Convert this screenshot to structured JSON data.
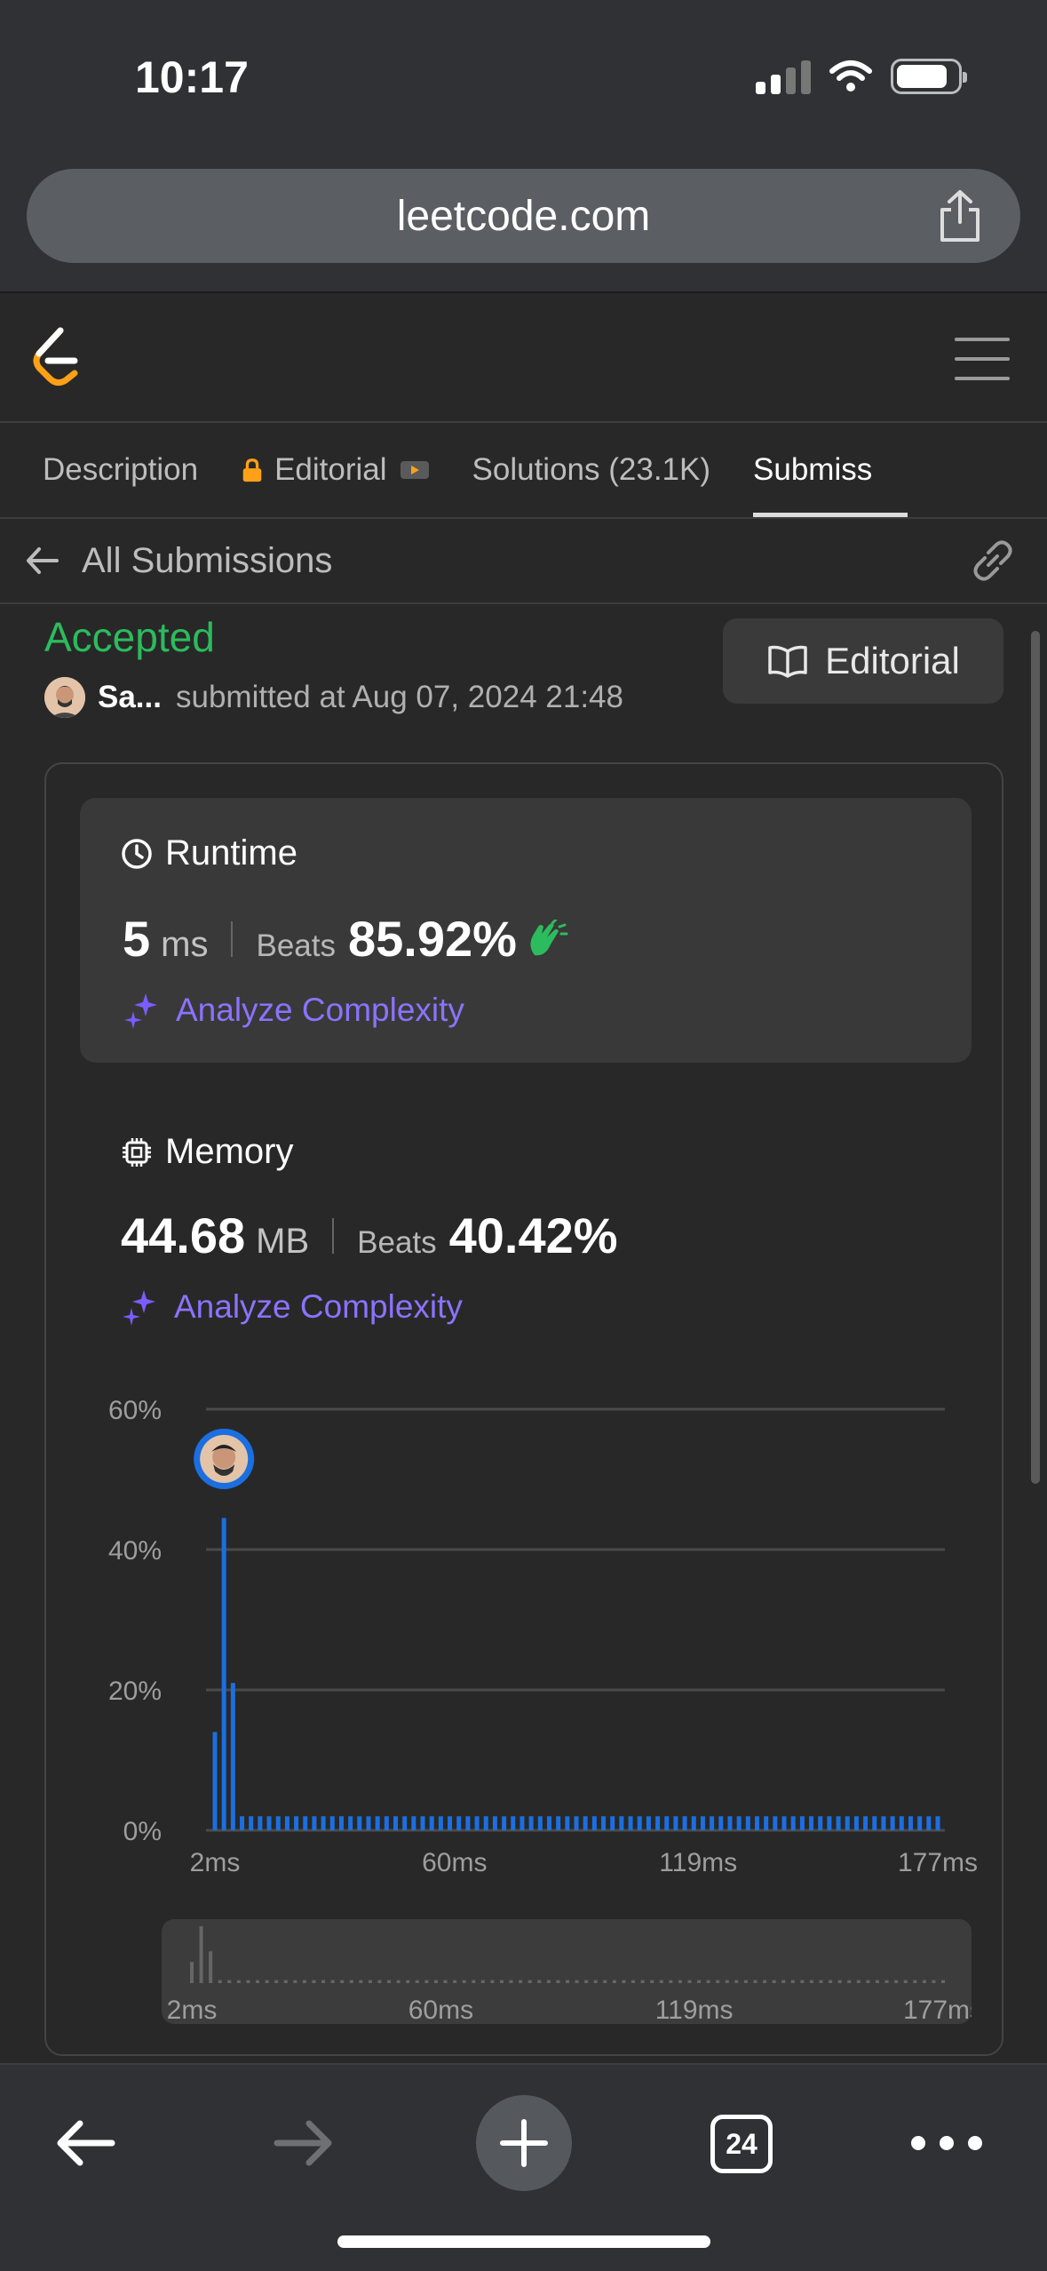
{
  "status_bar": {
    "time": "10:17"
  },
  "browser": {
    "url": "leetcode.com",
    "tab_count": "24"
  },
  "tabs": [
    {
      "label": "Description"
    },
    {
      "label": "Editorial"
    },
    {
      "label": "Solutions (23.1K)"
    },
    {
      "label": "Submiss"
    }
  ],
  "subnav": {
    "title": "All Submissions"
  },
  "submission": {
    "status": "Accepted",
    "user": "Sa...",
    "submitted_text": "submitted at Aug 07, 2024 21:48",
    "editorial_label": "Editorial"
  },
  "runtime": {
    "title": "Runtime",
    "value": "5",
    "unit": "ms",
    "beats_label": "Beats",
    "beats": "85.92%",
    "analyze_label": "Analyze Complexity"
  },
  "memory": {
    "title": "Memory",
    "value": "44.68",
    "unit": "MB",
    "beats_label": "Beats",
    "beats": "40.42%",
    "analyze_label": "Analyze Complexity"
  },
  "colors": {
    "accepted": "#2cbb5d",
    "bar": "#1b6fe0",
    "analyze": "#8b73ff"
  },
  "chart_data": {
    "type": "bar",
    "title": "",
    "xlabel": "",
    "ylabel": "",
    "ylim": [
      0,
      60
    ],
    "y_ticks": [
      "0%",
      "20%",
      "40%",
      "60%"
    ],
    "x_ticks": [
      "2ms",
      "60ms",
      "119ms",
      "177ms"
    ],
    "x_range_ms": [
      2,
      177
    ],
    "highlight_bar_index": 1,
    "series": [
      {
        "values": [
          14,
          44.5,
          21,
          2,
          2,
          2,
          2,
          2,
          2,
          2,
          2,
          2,
          2,
          2,
          2,
          2,
          2,
          2,
          2,
          2,
          2,
          2,
          2,
          2,
          2,
          2,
          2,
          2,
          2,
          2,
          2,
          2,
          2,
          2,
          2,
          2,
          2,
          2,
          2,
          2,
          2,
          2,
          2,
          2,
          2,
          2,
          2,
          2,
          2,
          2,
          2,
          2,
          2,
          2,
          2,
          2,
          2,
          2,
          2,
          2,
          2,
          2,
          2,
          2,
          2,
          2,
          2,
          2,
          2,
          2,
          2,
          2,
          2,
          2,
          2,
          2,
          2,
          2,
          2,
          2,
          2
        ]
      }
    ]
  }
}
